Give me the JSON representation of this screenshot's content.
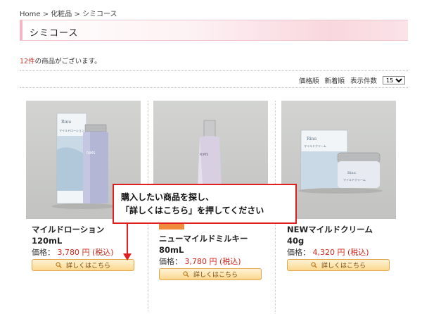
{
  "breadcrumb": {
    "home": "Home",
    "sep1": ">",
    "category": "化粧品",
    "sep2": ">",
    "current": "シミコース"
  },
  "page_title": "シミコース",
  "results": {
    "count": "12件",
    "suffix": "の商品がございます。"
  },
  "sort": {
    "price_label": "価格順",
    "new_label": "新着順",
    "per_page_label": "表示件数",
    "per_page_value": "15件"
  },
  "products": [
    {
      "name": "マイルドローション",
      "size": "120mL",
      "price_label": "価格：",
      "price": "3,780 円",
      "tax": "(税込)",
      "button_label": "詳しくはこちら",
      "box_brand": "Rinu",
      "box_text": "マイルドローション",
      "bottle_brand": "RIMS"
    },
    {
      "name": "ニューマイルドミルキー",
      "size": "80mL",
      "price_label": "価格：",
      "price": "3,780 円",
      "tax": "(税込)",
      "button_label": "詳しくはこちら",
      "bottle_brand": "RIMS"
    },
    {
      "name": "NEWマイルドクリーム",
      "size": "40g",
      "price_label": "価格：",
      "price": "4,320 円",
      "tax": "(税込)",
      "button_label": "詳しくはこちら",
      "box_brand": "Rinu",
      "box_text": "マイルドクリーム",
      "jar_brand": "Rinu",
      "jar_text": "マイルドクリーム"
    }
  ],
  "callout": {
    "line1": "購入したい商品を探し、",
    "line2": "「詳しくはこちら」を押してください"
  },
  "colors": {
    "accent_red": "#e02020",
    "price_red": "#d0261a",
    "button_orange": "#fbd88e",
    "title_pink": "#f9d7de"
  }
}
